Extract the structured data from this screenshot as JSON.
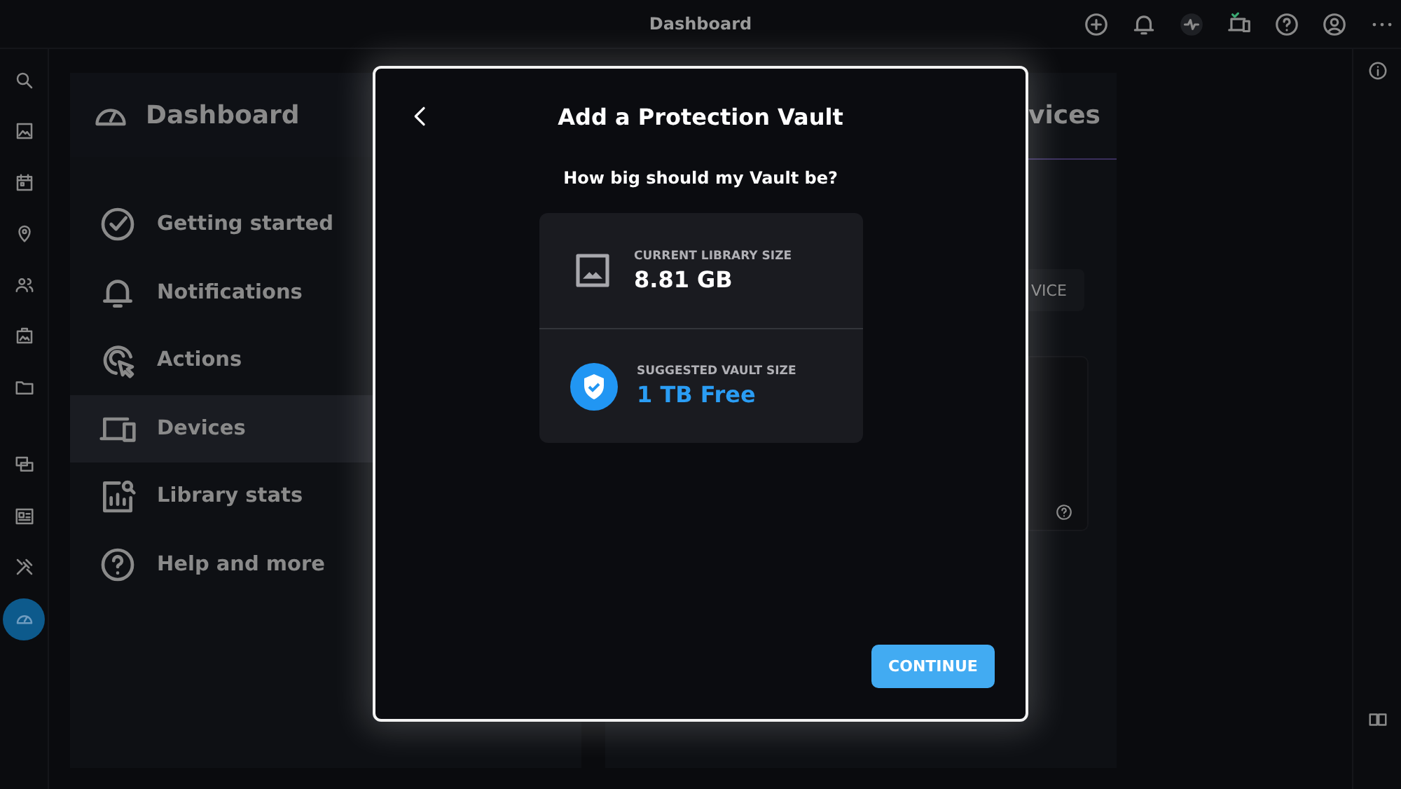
{
  "top_bar": {
    "title": "Dashboard"
  },
  "rail": [
    {
      "selected": false
    },
    {
      "selected": false
    },
    {
      "selected": false
    },
    {
      "selected": false
    },
    {
      "selected": false
    },
    {
      "selected": false
    },
    {
      "selected": false
    },
    {
      "selected": false
    },
    {
      "selected": false
    },
    {
      "selected": false
    },
    {
      "selected": true
    }
  ],
  "nav_panel": {
    "title": "Dashboard",
    "items": [
      {
        "label": "Getting started",
        "selected": false
      },
      {
        "label": "Notifications",
        "selected": false
      },
      {
        "label": "Actions",
        "selected": false
      },
      {
        "label": "Devices",
        "selected": true
      },
      {
        "label": "Library stats",
        "selected": false
      },
      {
        "label": "Help and more",
        "selected": false
      }
    ]
  },
  "devices_panel": {
    "title": "vices",
    "button": "VICE"
  },
  "dialog": {
    "title": "Add a Protection Vault",
    "question": "How big should my Vault be?",
    "rows": [
      {
        "kind": "library",
        "label": "CURRENT LIBRARY SIZE",
        "value": "8.81 GB"
      },
      {
        "kind": "vault",
        "label": "SUGGESTED VAULT SIZE",
        "value": "1 TB Free"
      }
    ],
    "button": "CONTINUE"
  }
}
